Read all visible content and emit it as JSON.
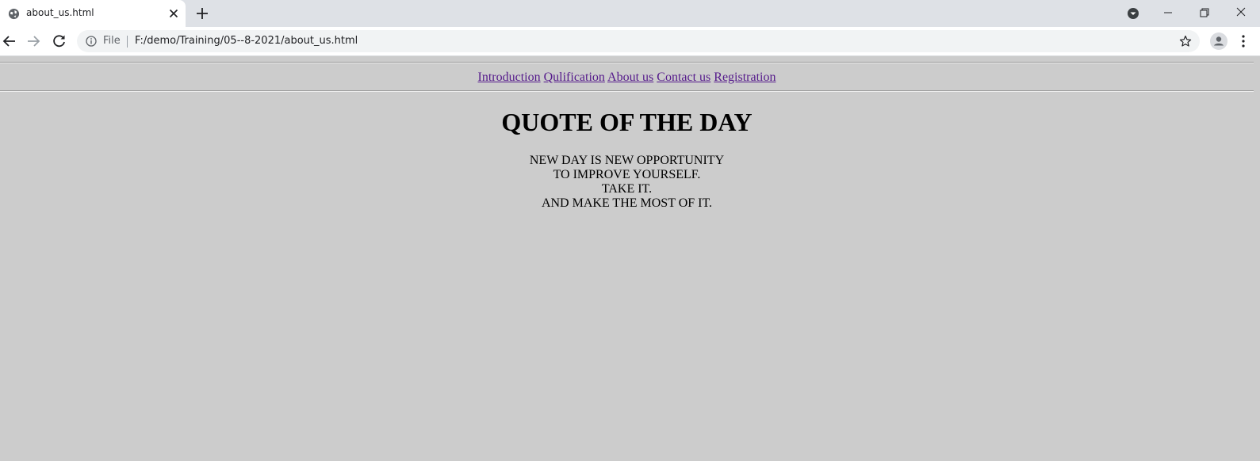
{
  "browser": {
    "tab_title": "about_us.html",
    "file_label": "File",
    "url": "F:/demo/Training/05--8-2021/about_us.html",
    "icons": {
      "favicon": "globe-icon",
      "tab_close": "close-icon",
      "new_tab": "plus-icon",
      "tab_search": "chevron-down-icon",
      "back": "arrow-left-icon",
      "forward": "arrow-right-icon",
      "reload": "reload-icon",
      "site_info": "info-icon",
      "bookmark": "star-icon",
      "profile": "profile-icon",
      "menu": "kebab-menu-icon"
    }
  },
  "page": {
    "background": "#cccccc",
    "link_color": "#551a8b",
    "nav_links": [
      "Introduction",
      "Qulification",
      "About us",
      "Contact us",
      "Registration"
    ],
    "heading": "QUOTE OF THE DAY",
    "quote_lines": [
      "NEW DAY IS NEW OPPORTUNITY",
      "TO IMPROVE YOURSELF.",
      "TAKE IT.",
      "AND MAKE THE MOST OF IT."
    ]
  }
}
